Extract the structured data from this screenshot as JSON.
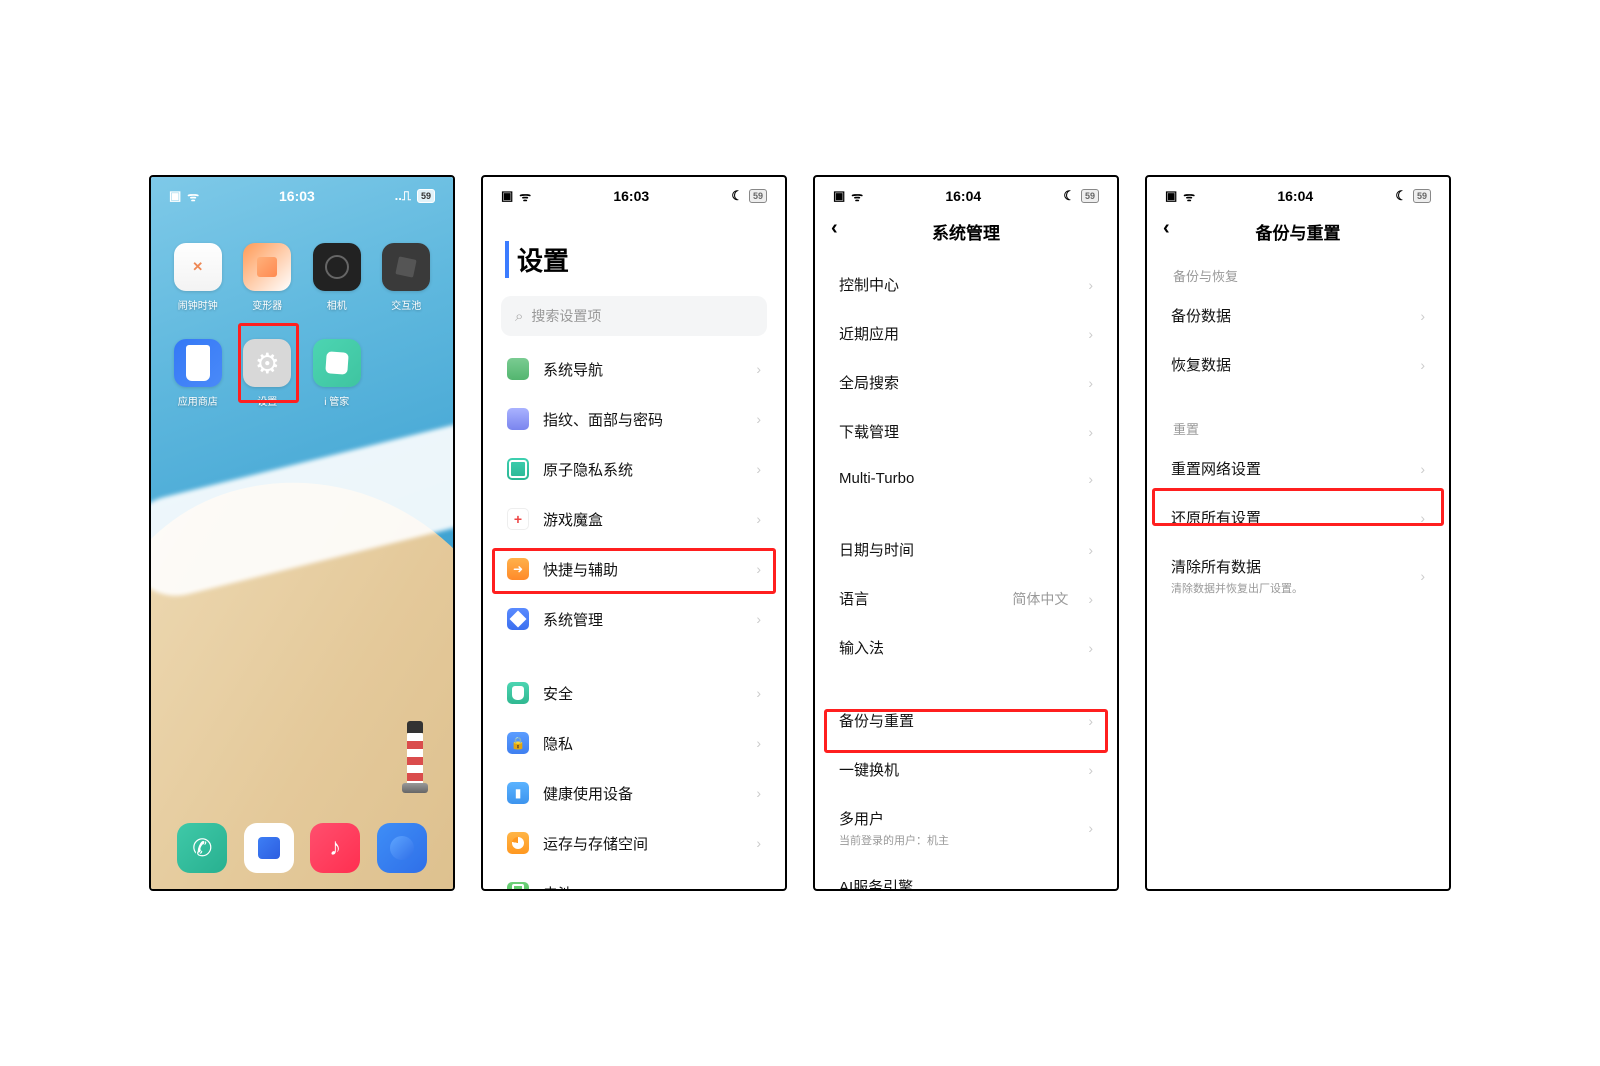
{
  "statusbar": {
    "time1": "16:03",
    "time2": "16:04",
    "battery": "59"
  },
  "home": {
    "apps": [
      {
        "name": "clock",
        "label": "闹钟时钟"
      },
      {
        "name": "box",
        "label": "变形器"
      },
      {
        "name": "camera",
        "label": "相机"
      },
      {
        "name": "cube",
        "label": "交互池"
      },
      {
        "name": "store",
        "label": "应用商店"
      },
      {
        "name": "settings",
        "label": "设置"
      },
      {
        "name": "imanager",
        "label": "i 管家"
      }
    ]
  },
  "settings": {
    "title": "设置",
    "search_placeholder": "搜索设置项",
    "rows": [
      {
        "icon": "nav",
        "label": "系统导航"
      },
      {
        "icon": "finger",
        "label": "指纹、面部与密码"
      },
      {
        "icon": "atom",
        "label": "原子隐私系统"
      },
      {
        "icon": "game",
        "label": "游戏魔盒"
      },
      {
        "icon": "quick",
        "label": "快捷与辅助"
      },
      {
        "icon": "sys",
        "label": "系统管理"
      },
      {
        "icon": "safe",
        "label": "安全"
      },
      {
        "icon": "priv",
        "label": "隐私"
      },
      {
        "icon": "health",
        "label": "健康使用设备"
      },
      {
        "icon": "storage",
        "label": "运存与存储空间"
      },
      {
        "icon": "batt",
        "label": "电池"
      }
    ]
  },
  "sysmgmt": {
    "title": "系统管理",
    "rows1": [
      {
        "label": "控制中心"
      },
      {
        "label": "近期应用"
      },
      {
        "label": "全局搜索"
      },
      {
        "label": "下载管理"
      },
      {
        "label": "Multi-Turbo"
      }
    ],
    "rows2": [
      {
        "label": "日期与时间"
      },
      {
        "label": "语言",
        "value": "简体中文"
      },
      {
        "label": "输入法"
      }
    ],
    "rows3": [
      {
        "label": "备份与重置"
      },
      {
        "label": "一键换机"
      },
      {
        "label": "多用户",
        "sub": "当前登录的用户：机主"
      },
      {
        "label": "AI服务引擎"
      }
    ]
  },
  "backup": {
    "title": "备份与重置",
    "section_backup": "备份与恢复",
    "rows_backup": [
      {
        "label": "备份数据"
      },
      {
        "label": "恢复数据"
      }
    ],
    "section_reset": "重置",
    "rows_reset": [
      {
        "label": "重置网络设置"
      },
      {
        "label": "还原所有设置"
      },
      {
        "label": "清除所有数据",
        "sub": "清除数据并恢复出厂设置。"
      }
    ]
  }
}
